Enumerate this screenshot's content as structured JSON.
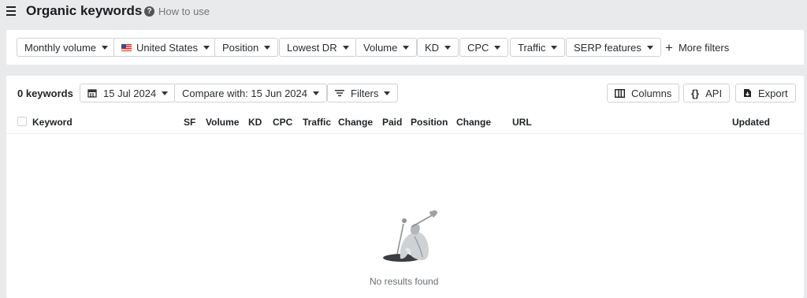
{
  "header": {
    "title": "Organic keywords",
    "how_to_use": "How to use"
  },
  "filters": {
    "items": [
      {
        "label": "Monthly volume"
      },
      {
        "label": "United States"
      },
      {
        "label": "Position"
      },
      {
        "label": "Lowest DR"
      },
      {
        "label": "Volume"
      },
      {
        "label": "KD"
      },
      {
        "label": "CPC"
      },
      {
        "label": "Traffic"
      },
      {
        "label": "SERP features"
      }
    ],
    "more_filters": "More filters"
  },
  "toolbar": {
    "keyword_count": "0 keywords",
    "date": "15 Jul 2024",
    "compare": "Compare with: 15 Jun 2024",
    "filters": "Filters",
    "columns": "Columns",
    "api": "API",
    "export": "Export"
  },
  "table": {
    "headers": [
      "Keyword",
      "SF",
      "Volume",
      "KD",
      "CPC",
      "Traffic",
      "Change",
      "Paid",
      "Position",
      "Change",
      "URL",
      "Updated"
    ]
  },
  "empty_state": {
    "message": "No results found"
  }
}
